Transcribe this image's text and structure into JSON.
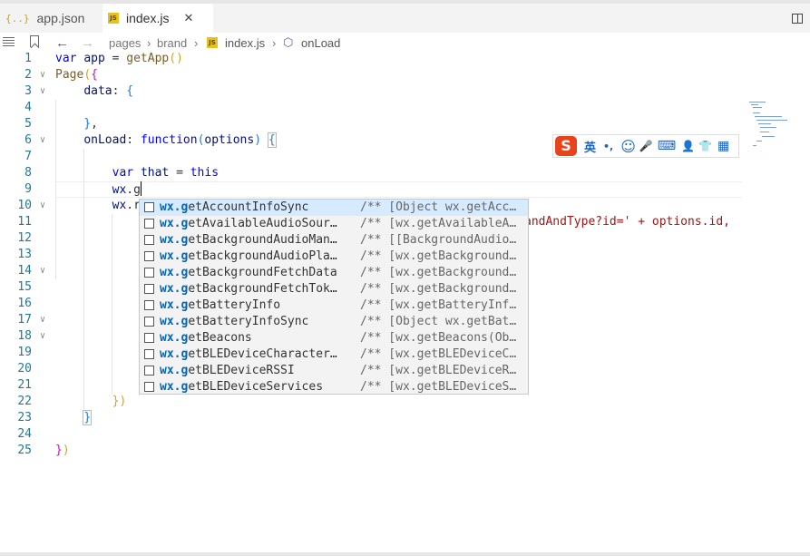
{
  "tabs": [
    {
      "icon": "{..}",
      "label": "app.json"
    },
    {
      "icon": "JS",
      "label": "index.js",
      "close": "✕"
    }
  ],
  "breadcrumb": {
    "back": "←",
    "forward": "→",
    "parts": [
      "pages",
      "brand",
      "index.js",
      "onLoad"
    ],
    "sep": "›"
  },
  "editor": {
    "line_numbers": [
      "1",
      "2",
      "3",
      "4",
      "5",
      "6",
      "7",
      "8",
      "9",
      "10",
      "11",
      "12",
      "13",
      "14",
      "15",
      "16",
      "17",
      "18",
      "19",
      "20",
      "21",
      "22",
      "23",
      "24",
      "25"
    ],
    "fold_marker": "∨",
    "line11_suffix": "andAndType?id=' + options.id,"
  },
  "ime": {
    "logo": "S",
    "items": [
      "英",
      "•,",
      "☺",
      "🎤",
      "⌨",
      "👤",
      "👕",
      "▦"
    ]
  },
  "suggestions": [
    {
      "prefix": "wx.g",
      "rest": "etAccountInfoSync",
      "detail": "/** [Object wx.getAcc…"
    },
    {
      "prefix": "wx.g",
      "rest": "etAvailableAudioSour…",
      "detail": "/** [wx.getAvailableA…"
    },
    {
      "prefix": "wx.g",
      "rest": "etBackgroundAudioMan…",
      "detail": "/** [[BackgroundAudio…"
    },
    {
      "prefix": "wx.g",
      "rest": "etBackgroundAudioPla…",
      "detail": "/** [wx.getBackground…"
    },
    {
      "prefix": "wx.g",
      "rest": "etBackgroundFetchData",
      "detail": "/** [wx.getBackground…"
    },
    {
      "prefix": "wx.g",
      "rest": "etBackgroundFetchTok…",
      "detail": "/** [wx.getBackground…"
    },
    {
      "prefix": "wx.g",
      "rest": "etBatteryInfo",
      "detail": "/** [wx.getBatteryInf…"
    },
    {
      "prefix": "wx.g",
      "rest": "etBatteryInfoSync",
      "detail": "/** [Object wx.getBat…"
    },
    {
      "prefix": "wx.g",
      "rest": "etBeacons",
      "detail": "/** [wx.getBeacons(Ob…"
    },
    {
      "prefix": "wx.g",
      "rest": "etBLEDeviceCharacter…",
      "detail": "/** [wx.getBLEDeviceC…"
    },
    {
      "prefix": "wx.g",
      "rest": "etBLEDeviceRSSI",
      "detail": "/** [wx.getBLEDeviceR…"
    },
    {
      "prefix": "wx.g",
      "rest": "etBLEDeviceServices",
      "detail": "/** [wx.getBLEDeviceS…"
    }
  ]
}
